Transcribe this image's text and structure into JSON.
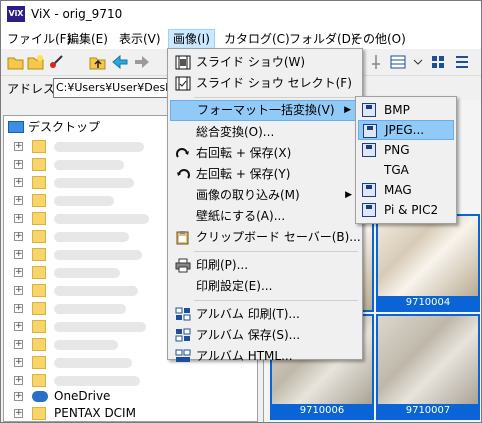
{
  "window": {
    "title": "ViX - orig_9710",
    "app_icon_text": "ViX"
  },
  "menubar": [
    {
      "label": "ファイル(F)"
    },
    {
      "label": "編集(E)"
    },
    {
      "label": "表示(V)"
    },
    {
      "label": "画像(I)"
    },
    {
      "label": "カタログ(C)"
    },
    {
      "label": "フォルダ(D)"
    },
    {
      "label": "その他(O)"
    }
  ],
  "address": {
    "label": "アドレス",
    "value": "C:¥Users¥User¥Deskt"
  },
  "tree": {
    "root_label": "デスクトップ",
    "onedrive_label": "OneDrive",
    "pentax_label": "PENTAX DCIM"
  },
  "thumbnails": [
    {
      "caption": "9710004"
    },
    {
      "caption": "9710006"
    },
    {
      "caption": "9710007"
    }
  ],
  "image_menu": {
    "items": [
      {
        "label": "スライド ショウ(W)",
        "icon": "film-icon"
      },
      {
        "label": "スライド ショウ セレクト(F)",
        "icon": "film-select-icon"
      },
      {
        "label": "フォーマット一括変換(V)",
        "icon": "",
        "submenu": true
      },
      {
        "label": "総合変換(O)...",
        "icon": ""
      },
      {
        "label": "右回転 + 保存(X)",
        "icon": "rotate-right-icon"
      },
      {
        "label": "左回転 + 保存(Y)",
        "icon": "rotate-left-icon"
      },
      {
        "label": "画像の取り込み(M)",
        "icon": "",
        "submenu": true
      },
      {
        "label": "壁紙にする(A)...",
        "icon": ""
      },
      {
        "label": "クリップボード セーバー(B)...",
        "icon": "clipboard-icon"
      },
      {
        "label": "印刷(P)...",
        "icon": "printer-icon"
      },
      {
        "label": "印刷設定(E)...",
        "icon": ""
      },
      {
        "label": "アルバム 印刷(T)...",
        "icon": "album-print-icon"
      },
      {
        "label": "アルバム 保存(S)...",
        "icon": "album-save-icon"
      },
      {
        "label": "アルバム HTML...",
        "icon": "album-html-icon"
      }
    ]
  },
  "format_submenu": {
    "items": [
      {
        "label": "BMP",
        "icon": "floppy-icon"
      },
      {
        "label": "JPEG...",
        "icon": "floppy-icon"
      },
      {
        "label": "PNG",
        "icon": "floppy-icon"
      },
      {
        "label": "TGA",
        "icon": ""
      },
      {
        "label": "MAG",
        "icon": "floppy-icon"
      },
      {
        "label": "Pi & PIC2",
        "icon": "floppy-icon"
      }
    ]
  },
  "colors": {
    "highlight": "#91c9f7",
    "selection_blue": "#0a64d6",
    "app_icon": "#2b1f86"
  }
}
